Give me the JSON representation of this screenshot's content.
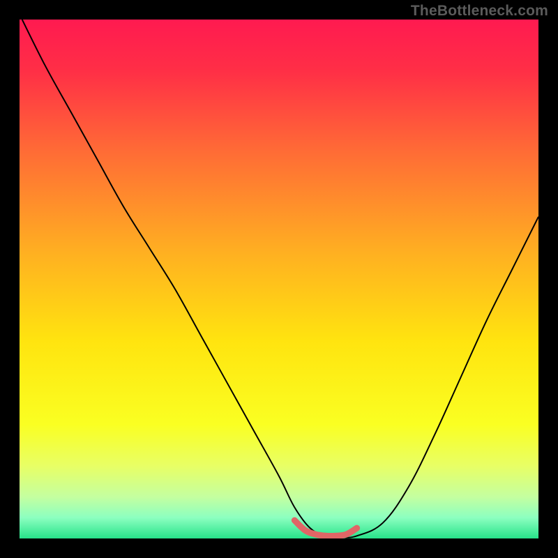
{
  "attribution": "TheBottleneck.com",
  "chart_data": {
    "type": "line",
    "title": "",
    "xlabel": "",
    "ylabel": "",
    "xlim": [
      0,
      100
    ],
    "ylim": [
      0,
      100
    ],
    "background_gradient": {
      "stops": [
        {
          "pos": 0.0,
          "color": "#ff1a50"
        },
        {
          "pos": 0.1,
          "color": "#ff2f46"
        },
        {
          "pos": 0.25,
          "color": "#ff6a36"
        },
        {
          "pos": 0.45,
          "color": "#ffb021"
        },
        {
          "pos": 0.62,
          "color": "#ffe40f"
        },
        {
          "pos": 0.78,
          "color": "#faff22"
        },
        {
          "pos": 0.86,
          "color": "#e8ff65"
        },
        {
          "pos": 0.92,
          "color": "#c4ffa0"
        },
        {
          "pos": 0.96,
          "color": "#8cffc0"
        },
        {
          "pos": 1.0,
          "color": "#27e38a"
        }
      ]
    },
    "series": [
      {
        "name": "bottleneck-curve",
        "color": "#000000",
        "stroke_width": 2,
        "x": [
          0.5,
          5,
          10,
          15,
          20,
          25,
          30,
          35,
          40,
          45,
          50,
          53,
          56,
          59,
          62,
          65,
          70,
          75,
          80,
          85,
          90,
          95,
          100
        ],
        "y": [
          100,
          91,
          82,
          73,
          64,
          56,
          48,
          39,
          30,
          21,
          12,
          6,
          2,
          0.4,
          0.2,
          0.5,
          3,
          10,
          20,
          31,
          42,
          52,
          62
        ]
      },
      {
        "name": "optimal-band",
        "color": "#e06666",
        "stroke_width": 9,
        "x": [
          53,
          55,
          57,
          59,
          61,
          63,
          65
        ],
        "y": [
          3.5,
          1.6,
          0.8,
          0.5,
          0.5,
          0.8,
          2.0
        ]
      }
    ]
  }
}
